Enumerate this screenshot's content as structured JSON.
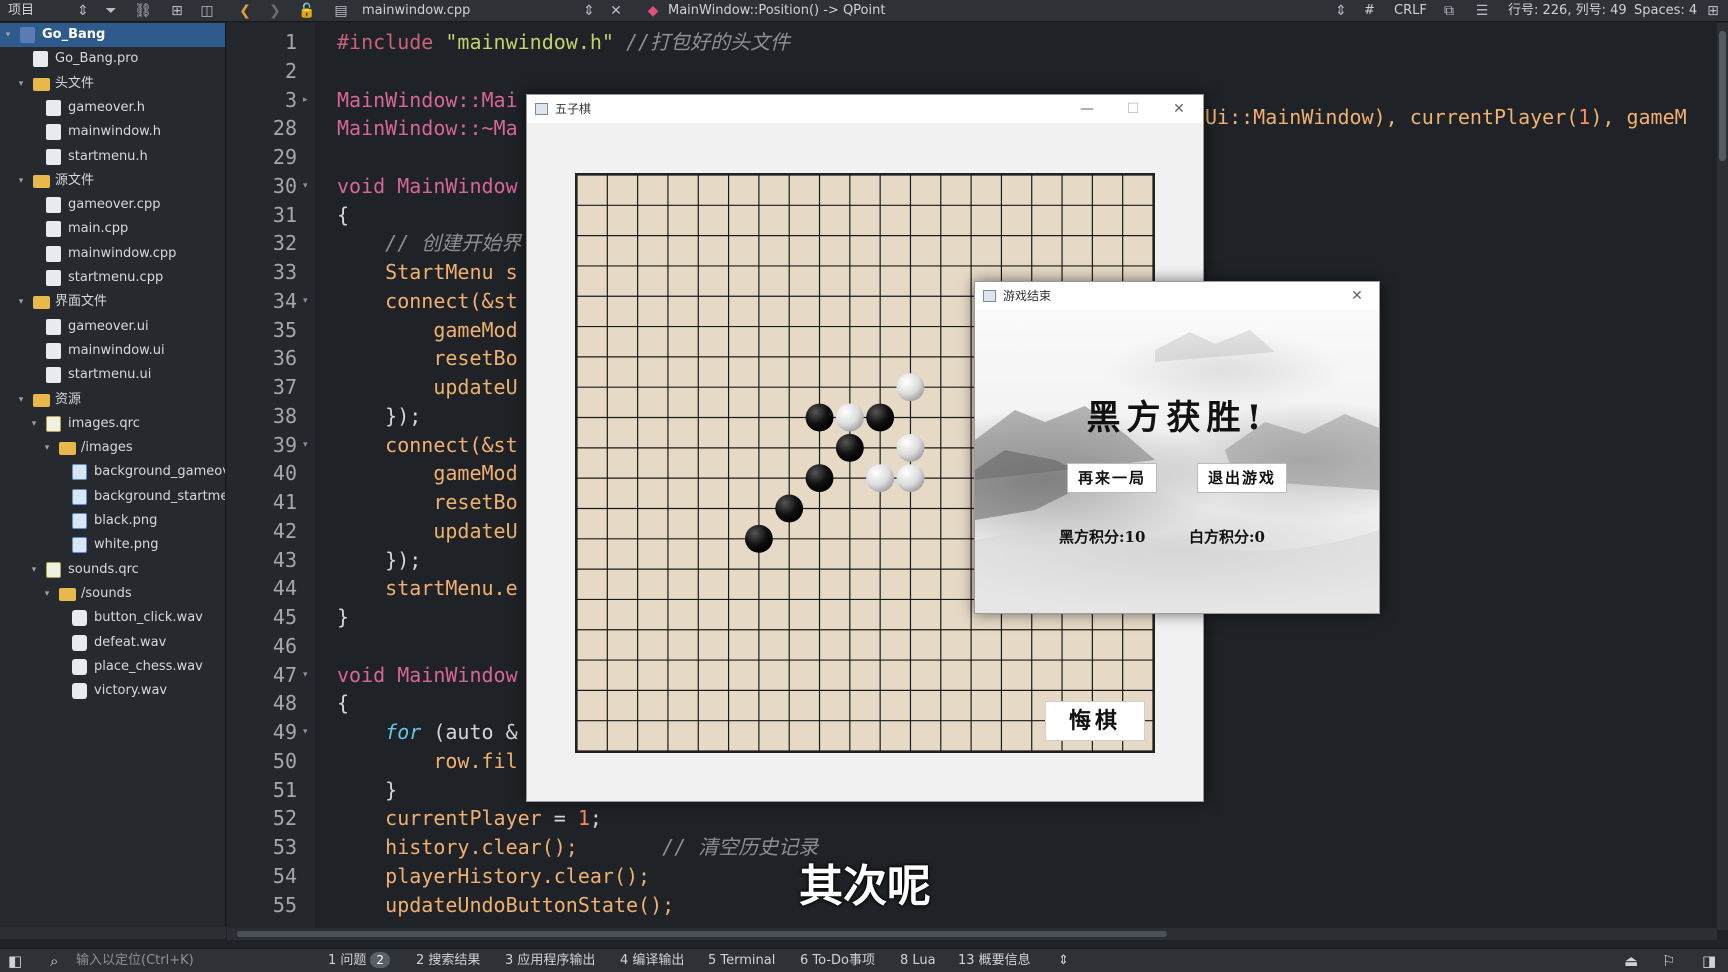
{
  "toolbar": {
    "panel_title": "项目",
    "file_name": "mainwindow.cpp",
    "function_name": "MainWindow::Position() -> QPoint",
    "hash": "#",
    "line_ending": "CRLF",
    "cursor_pos": "行号: 226, 列号: 49",
    "indent": "Spaces: 4"
  },
  "sidebar": {
    "items": [
      {
        "label": "Go_Bang",
        "level": 0,
        "arrow": "▾",
        "icon": "project-icon",
        "selected": true
      },
      {
        "label": "Go_Bang.pro",
        "level": 1,
        "arrow": "",
        "icon": "pro-file-icon"
      },
      {
        "label": "头文件",
        "level": 1,
        "arrow": "▾",
        "icon": "folder-icon"
      },
      {
        "label": "gameover.h",
        "level": 2,
        "arrow": "",
        "icon": "header-file-icon"
      },
      {
        "label": "mainwindow.h",
        "level": 2,
        "arrow": "",
        "icon": "header-file-icon"
      },
      {
        "label": "startmenu.h",
        "level": 2,
        "arrow": "",
        "icon": "header-file-icon"
      },
      {
        "label": "源文件",
        "level": 1,
        "arrow": "▾",
        "icon": "folder-icon"
      },
      {
        "label": "gameover.cpp",
        "level": 2,
        "arrow": "",
        "icon": "cpp-file-icon"
      },
      {
        "label": "main.cpp",
        "level": 2,
        "arrow": "",
        "icon": "cpp-file-icon"
      },
      {
        "label": "mainwindow.cpp",
        "level": 2,
        "arrow": "",
        "icon": "cpp-file-icon"
      },
      {
        "label": "startmenu.cpp",
        "level": 2,
        "arrow": "",
        "icon": "cpp-file-icon"
      },
      {
        "label": "界面文件",
        "level": 1,
        "arrow": "▾",
        "icon": "folder-icon"
      },
      {
        "label": "gameover.ui",
        "level": 2,
        "arrow": "",
        "icon": "ui-file-icon"
      },
      {
        "label": "mainwindow.ui",
        "level": 2,
        "arrow": "",
        "icon": "ui-file-icon"
      },
      {
        "label": "startmenu.ui",
        "level": 2,
        "arrow": "",
        "icon": "ui-file-icon"
      },
      {
        "label": "资源",
        "level": 1,
        "arrow": "▾",
        "icon": "folder-icon"
      },
      {
        "label": "images.qrc",
        "level": 2,
        "arrow": "▾",
        "icon": "qrc-file-icon"
      },
      {
        "label": "/images",
        "level": 3,
        "arrow": "▾",
        "icon": "folder-icon"
      },
      {
        "label": "background_gameove",
        "level": 4,
        "arrow": "",
        "icon": "image-file-icon"
      },
      {
        "label": "background_startmer",
        "level": 4,
        "arrow": "",
        "icon": "image-file-icon"
      },
      {
        "label": "black.png",
        "level": 4,
        "arrow": "",
        "icon": "image-file-icon"
      },
      {
        "label": "white.png",
        "level": 4,
        "arrow": "",
        "icon": "image-file-icon"
      },
      {
        "label": "sounds.qrc",
        "level": 2,
        "arrow": "▾",
        "icon": "qrc-file-icon"
      },
      {
        "label": "/sounds",
        "level": 3,
        "arrow": "▾",
        "icon": "folder-icon"
      },
      {
        "label": "button_click.wav",
        "level": 4,
        "arrow": "",
        "icon": "sound-file-icon"
      },
      {
        "label": "defeat.wav",
        "level": 4,
        "arrow": "",
        "icon": "sound-file-icon"
      },
      {
        "label": "place_chess.wav",
        "level": 4,
        "arrow": "",
        "icon": "sound-file-icon"
      },
      {
        "label": "victory.wav",
        "level": 4,
        "arrow": "",
        "icon": "sound-file-icon"
      }
    ]
  },
  "editor": {
    "lines": [
      {
        "n": "1",
        "fold": "",
        "segs": [
          [
            "pp",
            "#include "
          ],
          [
            "str",
            "\"mainwindow.h\""
          ],
          [
            "cm",
            " //打包好的头文件"
          ]
        ]
      },
      {
        "n": "2",
        "fold": "",
        "segs": []
      },
      {
        "n": "3",
        "fold": "▸",
        "segs": [
          [
            "kw",
            "MainWindow::Mai"
          ]
        ]
      },
      {
        "n": "28",
        "fold": "",
        "segs": [
          [
            "kw",
            "MainWindow::~Ma"
          ]
        ]
      },
      {
        "n": "29",
        "fold": "",
        "segs": []
      },
      {
        "n": "30",
        "fold": "▾",
        "segs": [
          [
            "kw",
            "void MainWindow"
          ]
        ]
      },
      {
        "n": "31",
        "fold": "",
        "segs": [
          [
            "tx",
            "{"
          ]
        ]
      },
      {
        "n": "32",
        "fold": "",
        "segs": [
          [
            "cm",
            "    // 创建开始界"
          ]
        ]
      },
      {
        "n": "33",
        "fold": "",
        "segs": [
          [
            "ty",
            "    StartMenu s"
          ]
        ]
      },
      {
        "n": "34",
        "fold": "▾",
        "segs": [
          [
            "ty",
            "    connect(&st"
          ]
        ]
      },
      {
        "n": "35",
        "fold": "",
        "segs": [
          [
            "ty",
            "        gameMod"
          ]
        ]
      },
      {
        "n": "36",
        "fold": "",
        "segs": [
          [
            "ty",
            "        resetBo"
          ]
        ]
      },
      {
        "n": "37",
        "fold": "",
        "segs": [
          [
            "ty",
            "        updateU"
          ]
        ]
      },
      {
        "n": "38",
        "fold": "",
        "segs": [
          [
            "tx",
            "    });"
          ]
        ]
      },
      {
        "n": "39",
        "fold": "▾",
        "segs": [
          [
            "ty",
            "    connect(&st"
          ]
        ]
      },
      {
        "n": "40",
        "fold": "",
        "segs": [
          [
            "ty",
            "        gameMod"
          ]
        ]
      },
      {
        "n": "41",
        "fold": "",
        "segs": [
          [
            "ty",
            "        resetBo"
          ]
        ]
      },
      {
        "n": "42",
        "fold": "",
        "segs": [
          [
            "ty",
            "        updateU"
          ]
        ]
      },
      {
        "n": "43",
        "fold": "",
        "segs": [
          [
            "tx",
            "    });"
          ]
        ]
      },
      {
        "n": "44",
        "fold": "",
        "segs": [
          [
            "ty",
            "    startMenu.e"
          ]
        ]
      },
      {
        "n": "45",
        "fold": "",
        "segs": [
          [
            "tx",
            "}"
          ]
        ]
      },
      {
        "n": "46",
        "fold": "",
        "segs": []
      },
      {
        "n": "47",
        "fold": "▾",
        "segs": [
          [
            "kw",
            "void MainWindow"
          ]
        ]
      },
      {
        "n": "48",
        "fold": "",
        "segs": [
          [
            "tx",
            "{"
          ]
        ]
      },
      {
        "n": "49",
        "fold": "▾",
        "segs": [
          [
            "it",
            "    for"
          ],
          [
            "tx",
            " (auto &"
          ]
        ]
      },
      {
        "n": "50",
        "fold": "",
        "segs": [
          [
            "ty",
            "        row.fil"
          ]
        ]
      },
      {
        "n": "51",
        "fold": "",
        "segs": [
          [
            "tx",
            "    }"
          ]
        ]
      },
      {
        "n": "52",
        "fold": "",
        "segs": [
          [
            "ty",
            "    currentPlayer"
          ],
          [
            "tx",
            " = "
          ],
          [
            "nm",
            "1"
          ],
          [
            "tx",
            ";"
          ]
        ]
      },
      {
        "n": "53",
        "fold": "",
        "segs": [
          [
            "ty",
            "    history.clear();"
          ],
          [
            "cm",
            "       // 清空历史记录"
          ]
        ]
      },
      {
        "n": "54",
        "fold": "",
        "segs": [
          [
            "ty",
            "    playerHistory.clear();"
          ]
        ]
      },
      {
        "n": "55",
        "fold": "",
        "segs": [
          [
            "ty",
            "    updateUndoButtonState();"
          ]
        ]
      }
    ],
    "line3_tail": [
      [
        "ty",
        "Ui::MainWindow), currentPlayer("
      ],
      [
        "nm",
        "1"
      ],
      [
        "ty",
        "), gameM"
      ]
    ]
  },
  "game_window": {
    "title": "五子棋",
    "undo_label": "悔棋",
    "board_size": 19,
    "stones": [
      {
        "color": "white",
        "row": 7,
        "col": 11
      },
      {
        "color": "black",
        "row": 8,
        "col": 8
      },
      {
        "color": "white",
        "row": 8,
        "col": 9
      },
      {
        "color": "black",
        "row": 8,
        "col": 10
      },
      {
        "color": "black",
        "row": 9,
        "col": 9
      },
      {
        "color": "white",
        "row": 9,
        "col": 11
      },
      {
        "color": "black",
        "row": 10,
        "col": 8
      },
      {
        "color": "white",
        "row": 10,
        "col": 10
      },
      {
        "color": "white",
        "row": 10,
        "col": 11
      },
      {
        "color": "black",
        "row": 11,
        "col": 7
      },
      {
        "color": "black",
        "row": 12,
        "col": 6
      }
    ]
  },
  "over_dialog": {
    "title": "游戏结束",
    "headline": "黑方获胜!",
    "again_label": "再来一局",
    "exit_label": "退出游戏",
    "black_score": "黑方积分:10",
    "white_score": "白方积分:0"
  },
  "statusbar": {
    "locator_placeholder": "输入以定位(Ctrl+K)",
    "tabs": [
      {
        "label": "1  问题",
        "badge": "2"
      },
      {
        "label": "2  搜索结果"
      },
      {
        "label": "3  应用程序输出"
      },
      {
        "label": "4  编译输出"
      },
      {
        "label": "5  Terminal"
      },
      {
        "label": "6  To-Do事项"
      },
      {
        "label": "8  Lua"
      },
      {
        "label": "13  概要信息"
      }
    ]
  },
  "subtitle": "其次呢"
}
